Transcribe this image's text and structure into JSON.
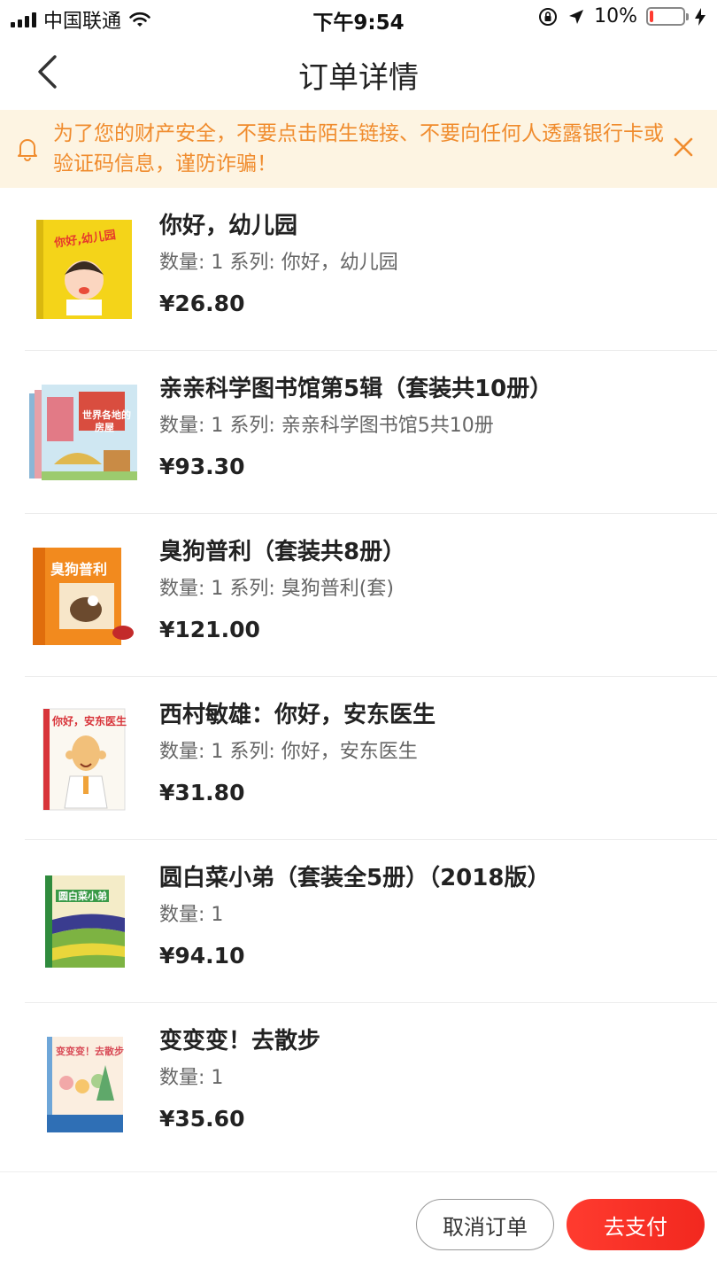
{
  "status_bar": {
    "carrier": "中国联通",
    "time": "下午9:54",
    "battery_percent_text": "10%",
    "battery_level": 0.1,
    "battery_color": "#ff3b30"
  },
  "nav": {
    "title": "订单详情"
  },
  "notice": {
    "text": "为了您的财产安全，不要点击陌生链接、不要向任何人透露银行卡或验证码信息，谨防诈骗！",
    "color": "#f08c2e",
    "background": "#fdf4e2"
  },
  "items": [
    {
      "title": "你好，幼儿园",
      "meta": "数量: 1 系列: 你好，幼儿园",
      "price": "¥26.80",
      "cover": "yellow-book-cover"
    },
    {
      "title": "亲亲科学图书馆第5辑（套装共10册）",
      "meta": "数量: 1 系列: 亲亲科学图书馆5共10册",
      "price": "¥93.30",
      "cover": "houses-book-set-cover"
    },
    {
      "title": " 臭狗普利（套装共8册）",
      "meta": "数量: 1 系列: 臭狗普利(套)",
      "price": "¥121.00",
      "cover": "orange-book-set-cover"
    },
    {
      "title": "西村敏雄：你好，安东医生",
      "meta": "数量: 1 系列: 你好，安东医生",
      "price": "¥31.80",
      "cover": "doctor-book-cover"
    },
    {
      "title": "圆白菜小弟（套装全5册）（2018版）",
      "meta": "数量: 1",
      "price": "¥94.10",
      "cover": "cabbage-book-cover"
    },
    {
      "title": "变变变！去散步",
      "meta": "数量: 1",
      "price": "¥35.60",
      "cover": "walk-book-cover"
    }
  ],
  "bottom": {
    "cancel_label": "取消订单",
    "pay_label": "去支付",
    "accent": "#f2281f"
  }
}
